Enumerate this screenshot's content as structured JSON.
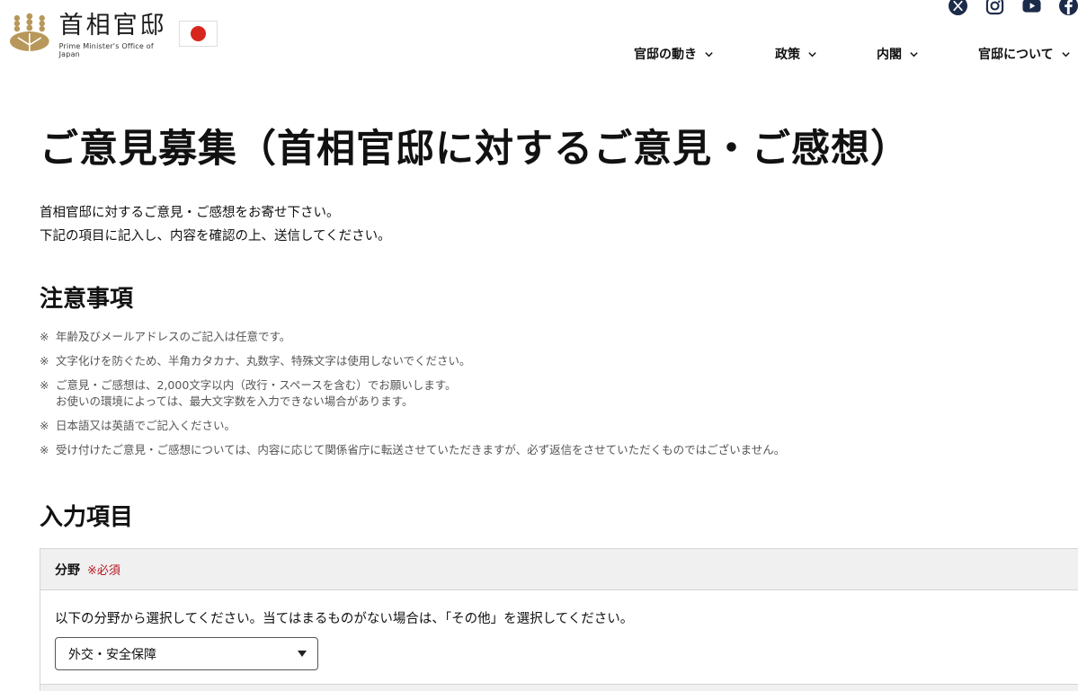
{
  "header": {
    "logo_ja": "首相官邸",
    "logo_en": "Prime Minister's Office of Japan",
    "social": [
      "x-icon",
      "instagram-icon",
      "youtube-icon",
      "facebook-icon"
    ],
    "nav": [
      {
        "label": "官邸の動き"
      },
      {
        "label": "政策"
      },
      {
        "label": "内閣"
      },
      {
        "label": "官邸について"
      }
    ]
  },
  "main": {
    "title": "ご意見募集（首相官邸に対するご意見・ご感想）",
    "intro": [
      "首相官邸に対するご意見・ご感想をお寄せ下さい。",
      "下記の項目に記入し、内容を確認の上、送信してください。"
    ],
    "notes_heading": "注意事項",
    "notes": [
      {
        "mark": "※",
        "lines": [
          "年齢及びメールアドレスのご記入は任意です。"
        ]
      },
      {
        "mark": "※",
        "lines": [
          "文字化けを防ぐため、半角カタカナ、丸数字、特殊文字は使用しないでください。"
        ]
      },
      {
        "mark": "※",
        "lines": [
          "ご意見・ご感想は、2,000文字以内（改行・スペースを含む）でお願いします。",
          "お使いの環境によっては、最大文字数を入力できない場合があります。"
        ]
      },
      {
        "mark": "※",
        "lines": [
          "日本語又は英語でご記入ください。"
        ]
      },
      {
        "mark": "※",
        "lines": [
          "受け付けたご意見・ご感想については、内容に応じて関係省庁に転送させていただきますが、必ず返信をさせていただくものではございません。"
        ]
      }
    ],
    "form_heading": "入力項目",
    "field": {
      "label": "分野",
      "required": "※必須",
      "description": "以下の分野から選択してください。当てはまるものがない場合は、「その他」を選択してください。",
      "selected": "外交・安全保障"
    }
  },
  "colors": {
    "flag_red": "#d7261d",
    "required_red": "#b5141c",
    "emblem_gold": "#b8975a",
    "social_navy": "#1c2b4a"
  }
}
